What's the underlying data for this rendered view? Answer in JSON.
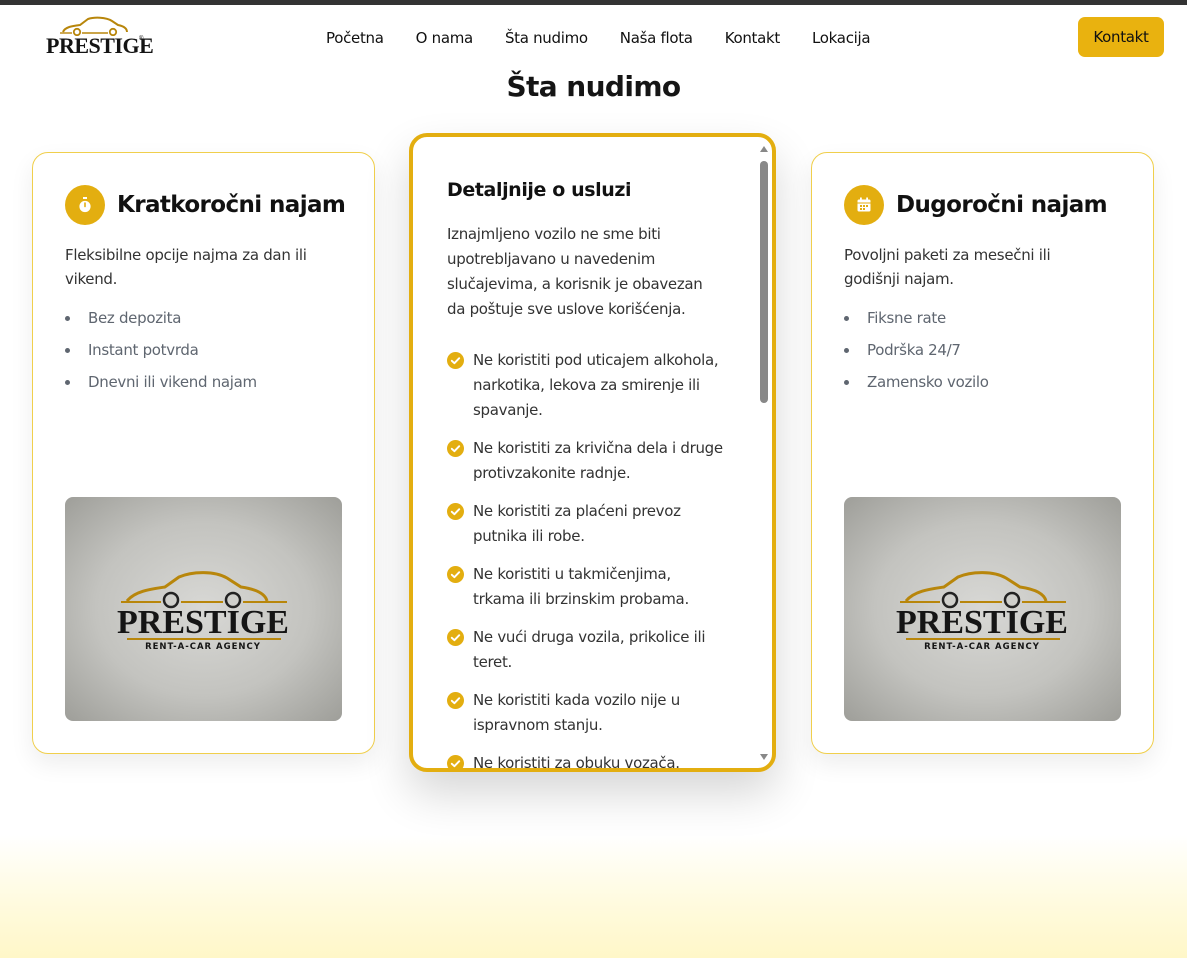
{
  "brand": {
    "logo_text": "PRESTIGE",
    "registered_mark": "®",
    "accent_color": "#e3ae10"
  },
  "nav": {
    "items": [
      "Početna",
      "O nama",
      "Šta nudimo",
      "Naša flota",
      "Kontakt",
      "Lokacija"
    ],
    "cta_label": "Kontakt"
  },
  "section": {
    "title": "Šta nudimo"
  },
  "cards": [
    {
      "icon": "stopwatch-icon",
      "title": "Kratkoročni najam",
      "description": "Fleksibilne opcije najma za dan ili vikend.",
      "features": [
        "Bez depozita",
        "Instant potvrda",
        "Dnevni ili vikend najam"
      ],
      "image_logo_text": "PRESTIGE",
      "image_tagline": "RENT-A-CAR AGENCY"
    },
    {
      "icon": "calendar-icon",
      "title": "Dugoročni najam",
      "description": "Povoljni paketi za mesečni ili godišnji najam.",
      "features": [
        "Fiksne rate",
        "Podrška 24/7",
        "Zamensko vozilo"
      ],
      "image_logo_text": "PRESTIGE",
      "image_tagline": "RENT-A-CAR AGENCY"
    }
  ],
  "detail": {
    "title": "Detaljnije o usluzi",
    "intro": "Iznajmljeno vozilo ne sme biti upotrebljavano u navedenim slučajevima, a korisnik je obavezan da poštuje sve uslove korišćenja.",
    "rules": [
      "Ne koristiti pod uticajem alkohola, narkotika, lekova za smirenje ili spavanje.",
      "Ne koristiti za krivična dela i druge protivzakonite radnje.",
      "Ne koristiti za plaćeni prevoz putnika ili robe.",
      "Ne koristiti u takmičenjima, trkama ili brzinskim probama.",
      "Ne vući druga vozila, prikolice ili teret.",
      "Ne koristiti kada vozilo nije u ispravnom stanju.",
      "Ne koristiti za obuku vozača."
    ]
  }
}
